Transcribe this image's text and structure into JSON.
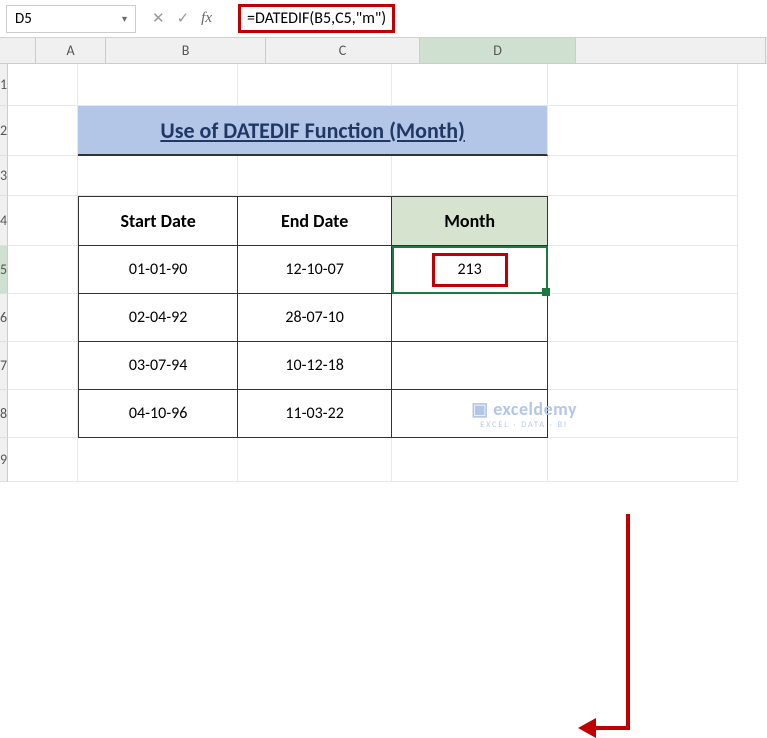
{
  "nameBox": "D5",
  "formula": "=DATEDIF(B5,C5,\"m\")",
  "columns": [
    "A",
    "B",
    "C",
    "D"
  ],
  "rows": [
    "1",
    "2",
    "3",
    "4",
    "5",
    "6",
    "7",
    "8",
    "9"
  ],
  "title": "Use of DATEDIF Function (Month)",
  "headers": {
    "start": "Start Date",
    "end": "End Date",
    "month": "Month"
  },
  "data": [
    {
      "start": "01-01-90",
      "end": "12-10-07",
      "month": "213"
    },
    {
      "start": "02-04-92",
      "end": "28-07-10",
      "month": ""
    },
    {
      "start": "03-07-94",
      "end": "10-12-18",
      "month": ""
    },
    {
      "start": "04-10-96",
      "end": "11-03-22",
      "month": ""
    }
  ],
  "fx": {
    "cancel": "✕",
    "confirm": "✓",
    "label": "fx"
  },
  "watermark": {
    "logo": "exceldemy",
    "tag": "EXCEL · DATA · BI"
  }
}
